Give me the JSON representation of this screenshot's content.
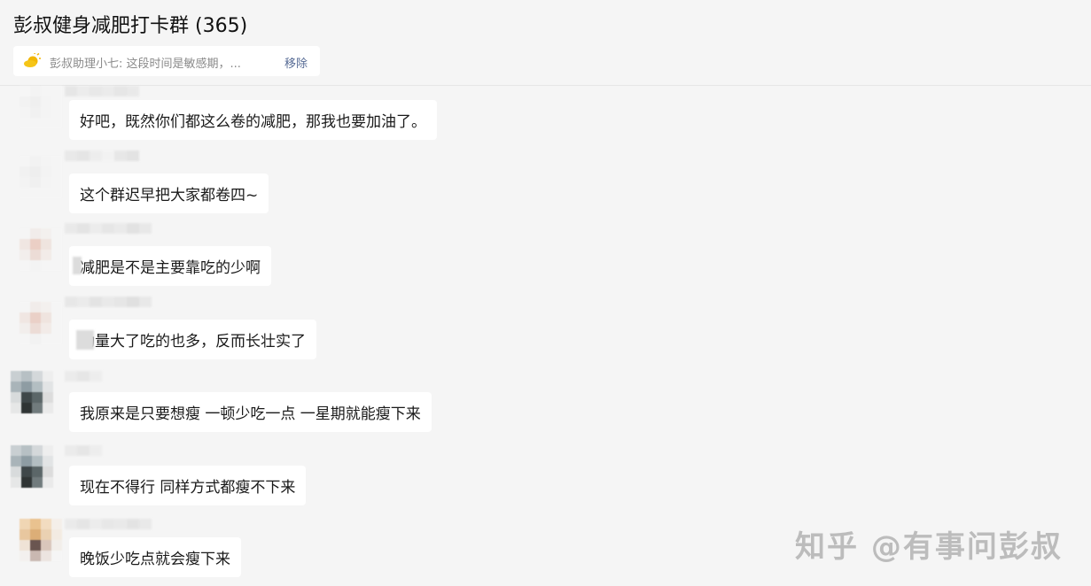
{
  "header": {
    "title": "彭叔健身减肥打卡群 (365)",
    "notice_text": "彭叔助理小七: 这段时间是敏感期，...",
    "notice_remove": "移除"
  },
  "messages": [
    {
      "text": "好吧，既然你们都这么卷的减肥，那我也要加油了。"
    },
    {
      "text": "这个群迟早把大家都卷四~"
    },
    {
      "text": "减肥是不是主要靠吃的少啊"
    },
    {
      "text": "动量大了吃的也多，反而长壮实了"
    },
    {
      "text": "我原来是只要想瘦 一顿少吃一点 一星期就能瘦下来"
    },
    {
      "text": "现在不得行 同样方式都瘦不下来"
    },
    {
      "text": "晚饭少吃点就会瘦下来"
    }
  ],
  "watermark": "知乎 @有事问彭叔",
  "colors": {
    "background": "#f5f5f5",
    "bubble": "#ffffff",
    "link": "#576b95"
  }
}
